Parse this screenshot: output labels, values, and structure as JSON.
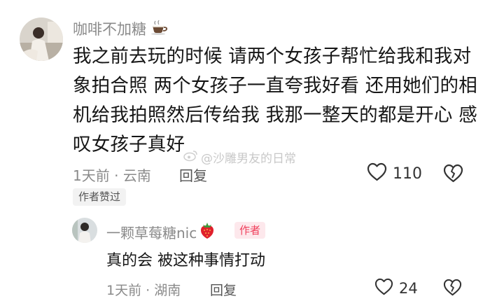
{
  "comment": {
    "username": "咖啡不加糖",
    "username_emoji": "coffee-cup-icon",
    "lines": [
      "我之前去玩的时候 请两个女孩子帮忙给我和我对",
      "象拍合照 两个女孩子一直夸我好看 还用她们的相",
      "机给我拍照然后传给我 我那一整天的都是开心 感",
      "叹女孩子真好"
    ],
    "time": "1天前",
    "separator": "·",
    "location": "云南",
    "reply_label": "回复",
    "likes": "110",
    "author_liked_badge": "作者赞过"
  },
  "watermark": {
    "text": "@沙雕男友的日常",
    "icon": "weibo-logo-icon"
  },
  "reply": {
    "username": "一颗草莓糖nic",
    "username_emoji": "strawberry-icon",
    "author_badge": "作者",
    "text": "真的会 被这种事情打动",
    "time": "1天前",
    "separator": "·",
    "location": "湖南",
    "reply_label": "回复",
    "likes": "24"
  },
  "colors": {
    "muted_text": "#8a8a8a",
    "author_badge_text": "#f0405c",
    "author_badge_bg": "#fde8ec",
    "liked_badge_bg": "#f2f2f2"
  }
}
